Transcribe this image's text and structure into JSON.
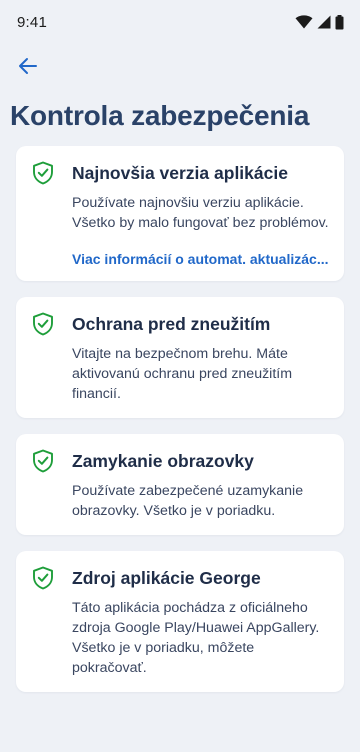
{
  "status_bar": {
    "time": "9:41"
  },
  "page": {
    "title": "Kontrola zabezpečenia"
  },
  "colors": {
    "accent": "#2168c9",
    "check_green": "#1e9e3a",
    "title": "#2a4268"
  },
  "cards": [
    {
      "icon": "shield-check-icon",
      "title": "Najnovšia verzia aplikácie",
      "body": "Používate najnovšiu verziu aplikácie. Všetko by malo fungovať bez problémov.",
      "link": "Viac informácií o automat. aktualizác..."
    },
    {
      "icon": "shield-check-icon",
      "title": "Ochrana pred zneužitím",
      "body": "Vitajte na bezpečnom brehu. Máte aktivovanú ochranu pred zneužitím financií."
    },
    {
      "icon": "shield-check-icon",
      "title": "Zamykanie obrazovky",
      "body": "Používate zabezpečené uzamykanie obrazovky. Všetko je v poriadku."
    },
    {
      "icon": "shield-check-icon",
      "title": "Zdroj aplikácie George",
      "body": "Táto aplikácia pochádza z oficiálneho zdroja Google Play/Huawei AppGallery. Všetko je v poriadku, môžete pokračovať."
    }
  ]
}
